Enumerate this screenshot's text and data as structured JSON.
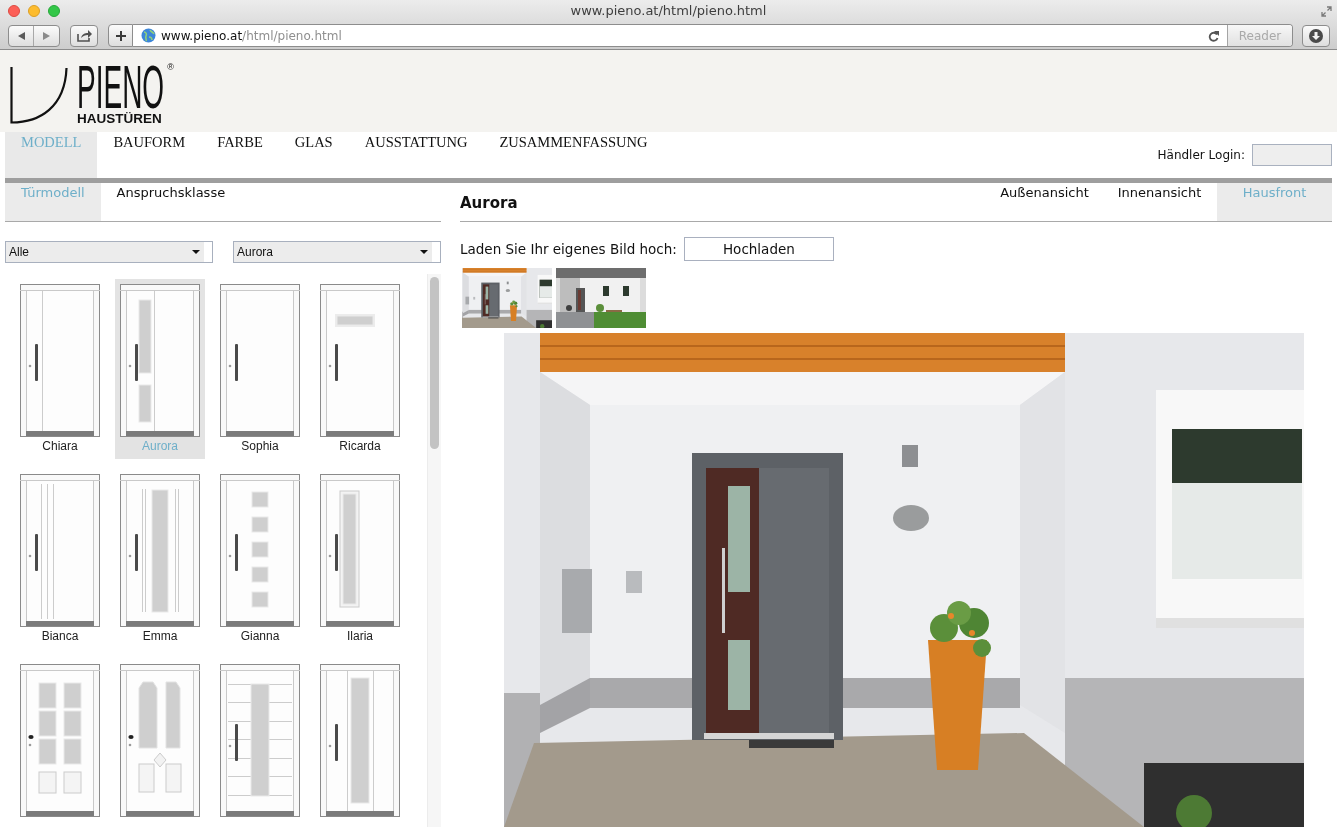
{
  "browser": {
    "title": "www.pieno.at/html/pieno.html",
    "url_host": "www.pieno.at",
    "url_path": "/html/pieno.html",
    "reader": {
      "label": "Reader",
      "disabled": true
    }
  },
  "logo": {
    "wordmark": "PIENO",
    "mark": "®",
    "tagline": "HAUSTÜREN"
  },
  "nav": [
    {
      "label": "MODELL",
      "selected": true
    },
    {
      "label": "BAUFORM",
      "selected": false
    },
    {
      "label": "FARBE",
      "selected": false
    },
    {
      "label": "GLAS",
      "selected": false
    },
    {
      "label": "AUSSTATTUNG",
      "selected": false
    },
    {
      "label": "ZUSAMMENFASSUNG",
      "selected": false
    }
  ],
  "dealer_login": {
    "label": "Händler Login:"
  },
  "model_tabs": [
    {
      "label": "Türmodell",
      "selected": true
    },
    {
      "label": "Anspruchsklasse",
      "selected": false
    }
  ],
  "filters": [
    {
      "value": "Alle"
    },
    {
      "value": "Aurora"
    }
  ],
  "doors": [
    {
      "name": "Chiara",
      "kind": "side-line",
      "selected": false
    },
    {
      "name": "Aurora",
      "kind": "split-panes",
      "selected": true
    },
    {
      "name": "Sophia",
      "kind": "plain",
      "selected": false
    },
    {
      "name": "Ricarda",
      "kind": "top-window",
      "selected": false
    },
    {
      "name": "Bianca",
      "kind": "grooves",
      "selected": false
    },
    {
      "name": "Emma",
      "kind": "center-glass",
      "selected": false
    },
    {
      "name": "Gianna",
      "kind": "squares",
      "selected": false
    },
    {
      "name": "Ilaria",
      "kind": "framed-glass",
      "selected": false
    },
    {
      "kind": "six-panes",
      "selected": false
    },
    {
      "kind": "arched-panes",
      "selected": false
    },
    {
      "kind": "lined-glass",
      "selected": false
    },
    {
      "kind": "wide-glass",
      "selected": false
    }
  ],
  "preview": {
    "title": "Aurora",
    "views": [
      {
        "label": "Außenansicht",
        "selected": false
      },
      {
        "label": "Innenansicht",
        "selected": false
      },
      {
        "label": "Hausfront",
        "selected": true
      }
    ],
    "upload": {
      "label": "Laden Sie Ihr eigenes Bild hoch:",
      "button": "Hochladen"
    }
  }
}
